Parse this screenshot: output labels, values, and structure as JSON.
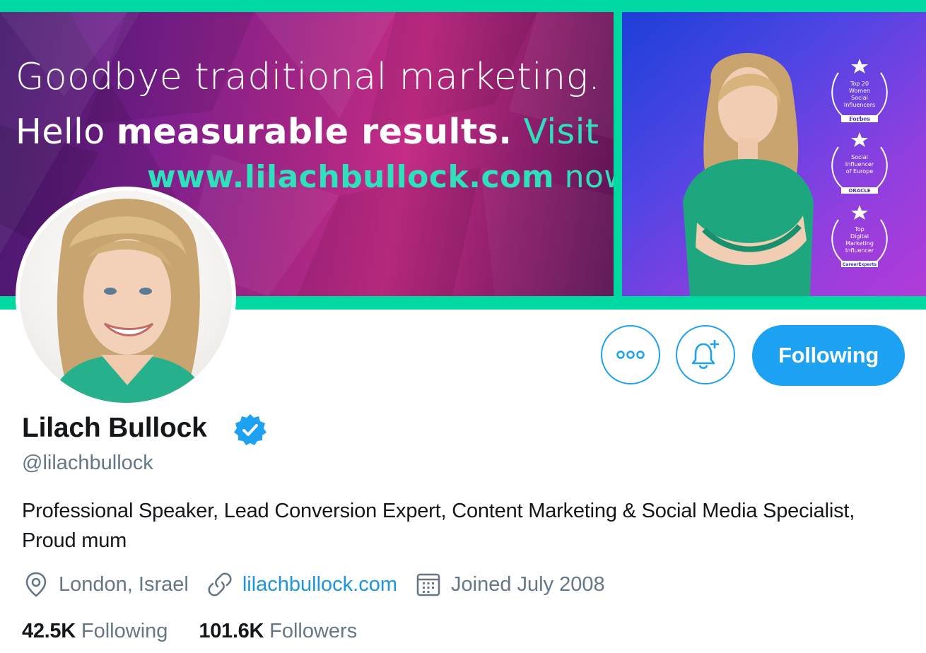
{
  "banner": {
    "line1": "Goodbye traditional marketing.",
    "line2_regular": "Hello ",
    "line2_bold": "measurable results.",
    "line2_tail": " Visit",
    "line3_bold": "www.lilachbullock.com",
    "line3_tail": " now!",
    "awards": [
      {
        "text": "Top 20 Women Social Influencers",
        "source": "Forbes"
      },
      {
        "text": "Social Influencer of Europe",
        "source": "ORACLE"
      },
      {
        "text": "Top Digital Marketing Influencer",
        "source": "CareerExperts"
      }
    ]
  },
  "actions": {
    "following_label": "Following"
  },
  "profile": {
    "name": "Lilach Bullock",
    "handle": "@lilachbullock",
    "bio": "Professional Speaker, Lead Conversion Expert, Content Marketing & Social Media Specialist, Proud mum",
    "location": "London, Israel",
    "website": "lilachbullock.com",
    "joined": "Joined July 2008"
  },
  "stats": {
    "following_count": "42.5K",
    "following_label": "Following",
    "followers_count": "101.6K",
    "followers_label": "Followers"
  },
  "colors": {
    "accent": "#1da1f2",
    "banner_border": "#00d8a2",
    "secondary_text": "#657786"
  },
  "icons": [
    "more-icon",
    "notification-add-icon",
    "verified-badge-icon",
    "location-icon",
    "link-icon",
    "calendar-icon"
  ]
}
